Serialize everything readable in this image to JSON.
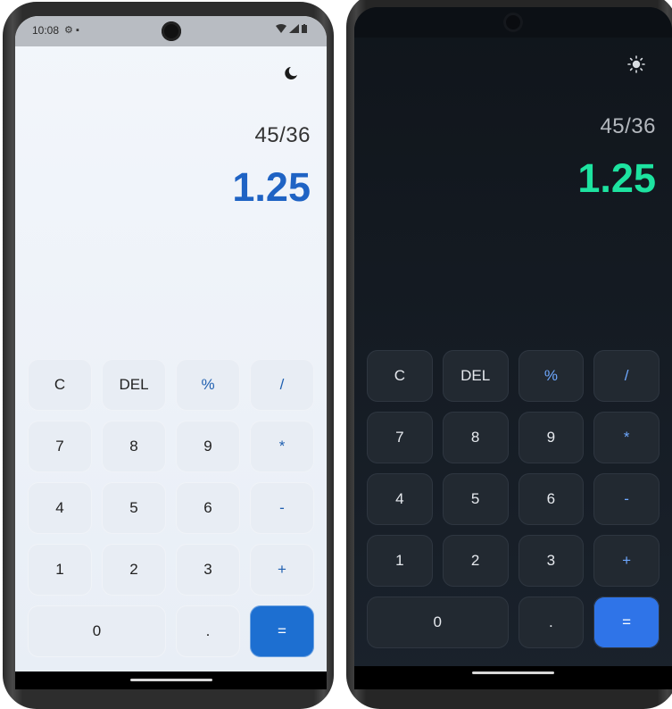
{
  "light": {
    "status": {
      "time": "10:08",
      "left_icons": [
        "gear-icon",
        "sim-card-icon"
      ],
      "right_icons": [
        "wifi-icon",
        "signal-icon",
        "battery-icon"
      ]
    },
    "theme_toggle_icon": "moon-icon",
    "display": {
      "expression": "45/36",
      "result": "1.25"
    },
    "colors": {
      "result": "#1f63c4",
      "equals_bg": "#1d6fd1",
      "operator": "#1f5fb0"
    },
    "keys": {
      "clear": "C",
      "delete": "DEL",
      "percent": "%",
      "divide": "/",
      "seven": "7",
      "eight": "8",
      "nine": "9",
      "multiply": "*",
      "four": "4",
      "five": "5",
      "six": "6",
      "minus": "-",
      "one": "1",
      "two": "2",
      "three": "3",
      "plus": "+",
      "zero": "0",
      "decimal": ".",
      "equals": "="
    }
  },
  "dark": {
    "theme_toggle_icon": "sun-icon",
    "display": {
      "expression": "45/36",
      "result": "1.25"
    },
    "colors": {
      "result": "#1de3a0",
      "equals_bg": "#2f74e8",
      "operator": "#6ea8ff"
    },
    "keys": {
      "clear": "C",
      "delete": "DEL",
      "percent": "%",
      "divide": "/",
      "seven": "7",
      "eight": "8",
      "nine": "9",
      "multiply": "*",
      "four": "4",
      "five": "5",
      "six": "6",
      "minus": "-",
      "one": "1",
      "two": "2",
      "three": "3",
      "plus": "+",
      "zero": "0",
      "decimal": ".",
      "equals": "="
    }
  }
}
